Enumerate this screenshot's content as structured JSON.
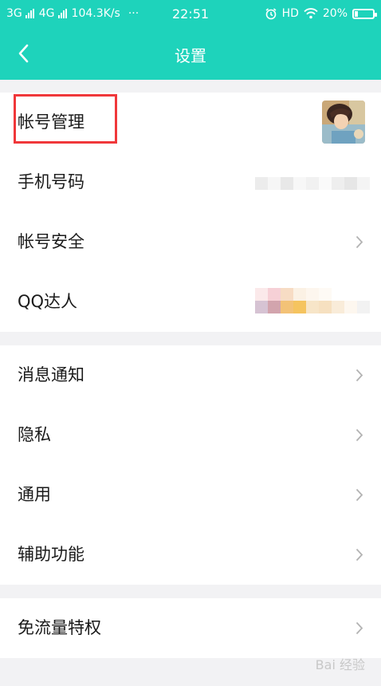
{
  "status": {
    "net1": "3G",
    "net2": "4G",
    "speed": "104.3K/s",
    "dots": "···",
    "time": "22:51",
    "hd": "HD",
    "battery": "20%",
    "battery_level": 0.2
  },
  "nav": {
    "title": "设置"
  },
  "groups": [
    {
      "items": [
        {
          "label": "帐号管理"
        },
        {
          "label": "手机号码"
        },
        {
          "label": "帐号安全"
        },
        {
          "label": "QQ达人"
        }
      ]
    },
    {
      "items": [
        {
          "label": "消息通知"
        },
        {
          "label": "隐私"
        },
        {
          "label": "通用"
        },
        {
          "label": "辅助功能"
        }
      ]
    },
    {
      "items": [
        {
          "label": "免流量特权"
        }
      ]
    }
  ],
  "colors": {
    "header": "#1ed3bb",
    "highlight": "#f0373a"
  },
  "watermark": "Bai 经验"
}
